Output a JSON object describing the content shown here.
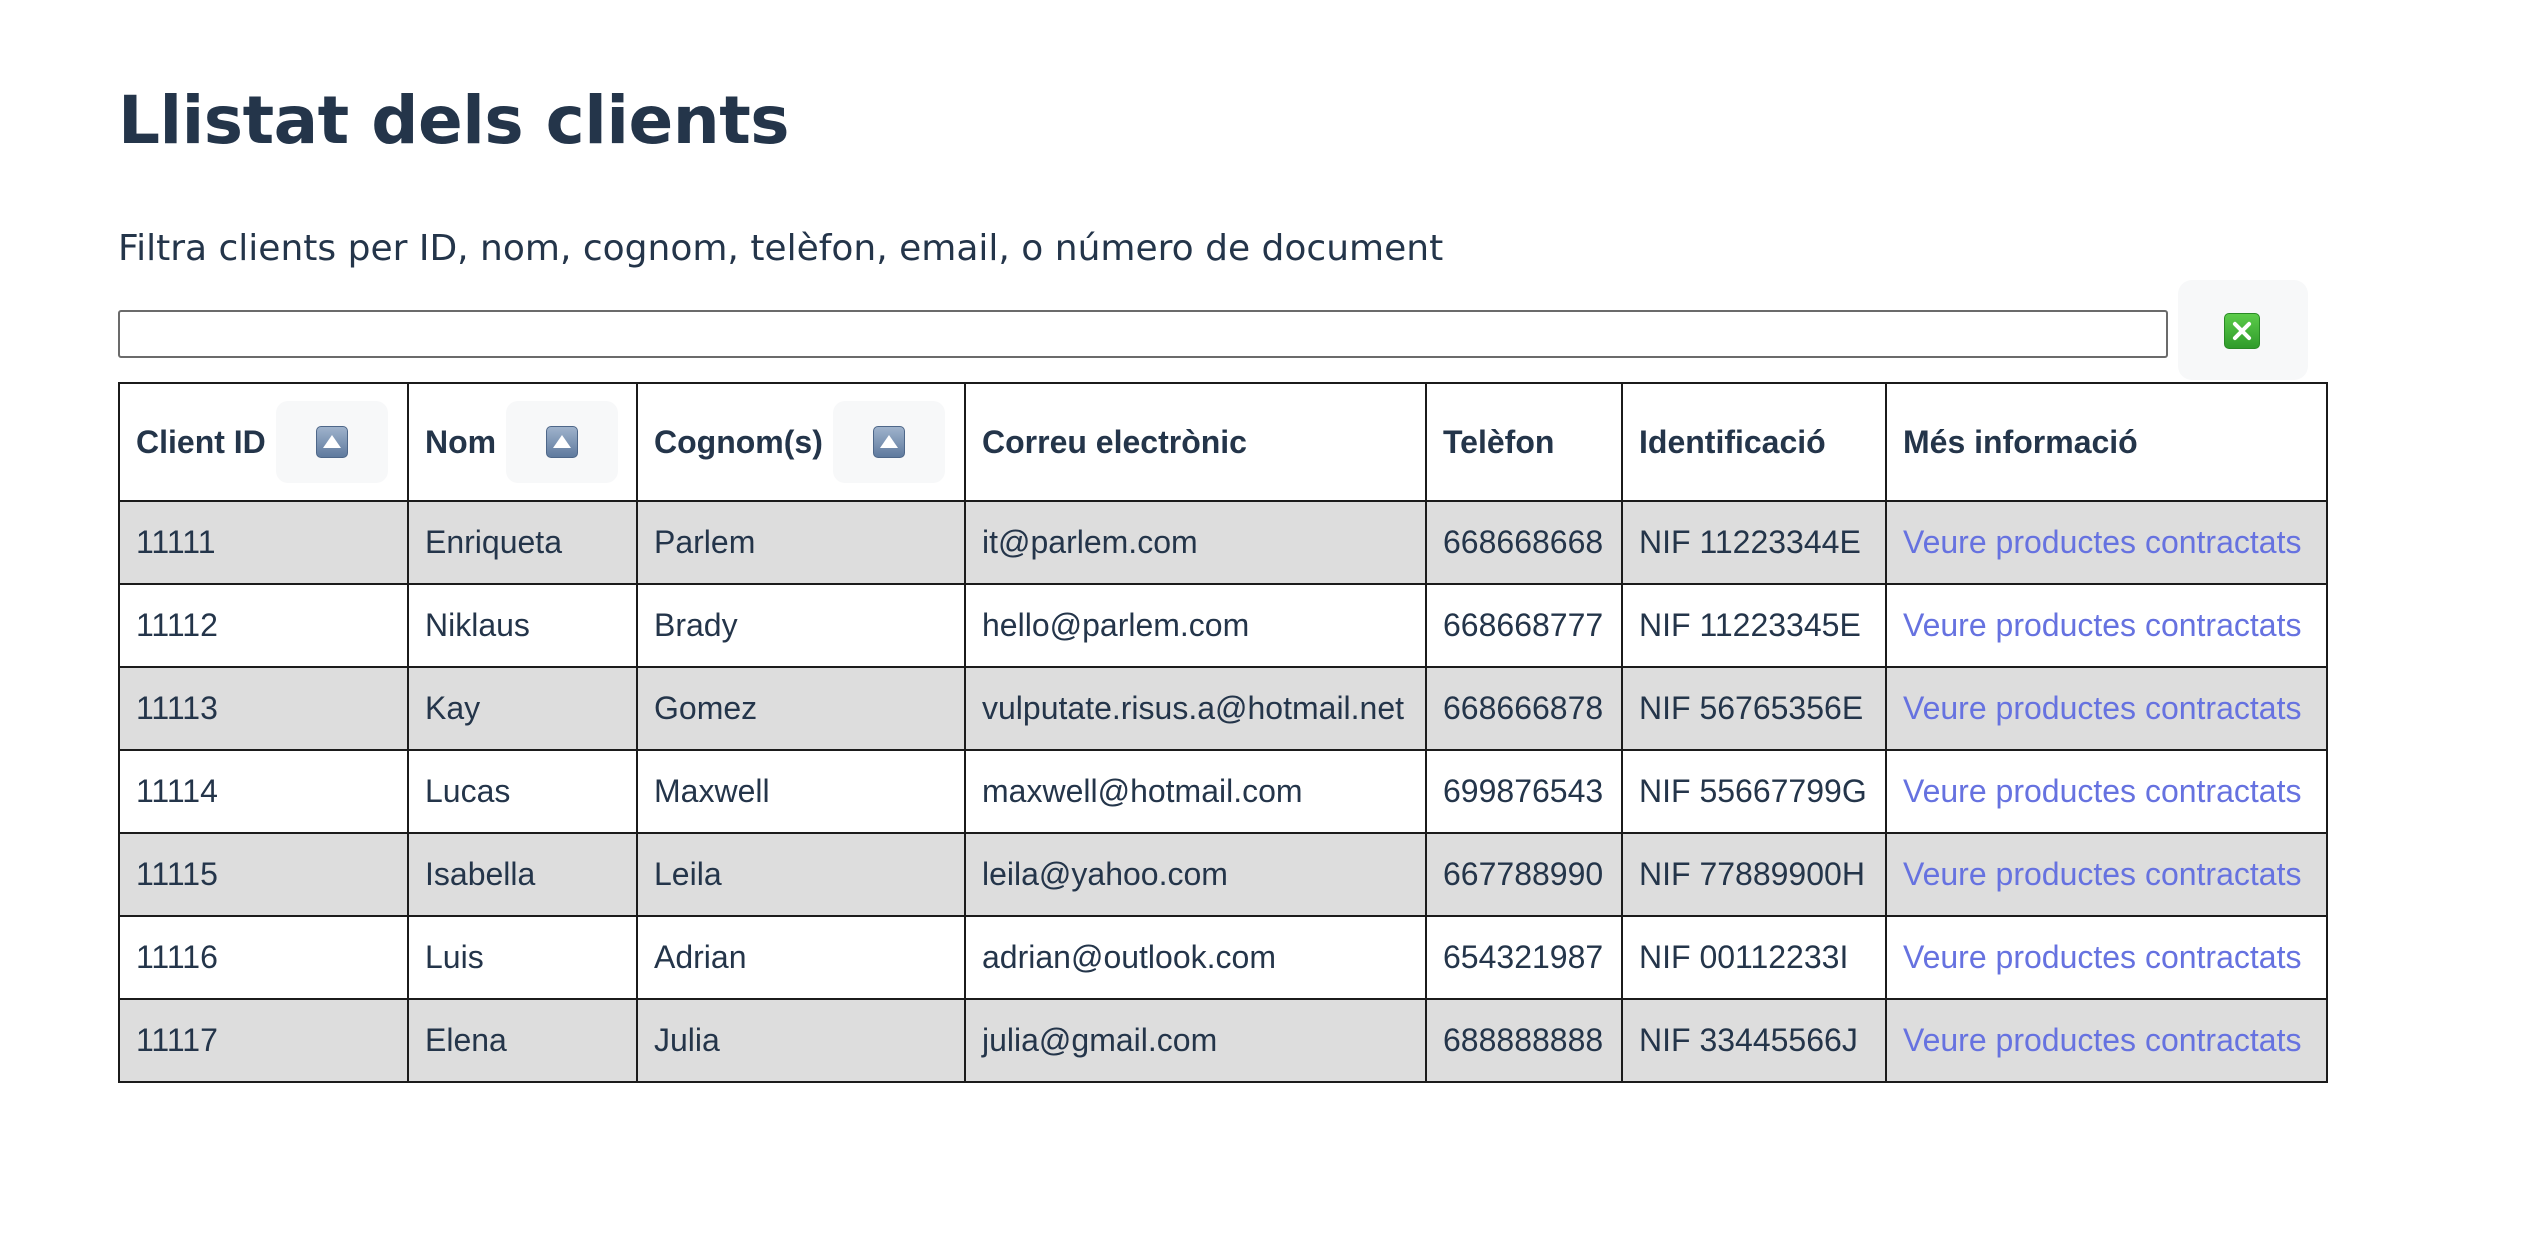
{
  "page": {
    "title": "Llistat dels clients"
  },
  "filter": {
    "label": "Filtra clients per ID, nom, cognom, telèfon, email, o número de document",
    "value": "",
    "placeholder": "",
    "clear_icon": "clear-x-icon"
  },
  "table": {
    "headers": {
      "client_id": "Client ID",
      "nom": "Nom",
      "cognom": "Cognom(s)",
      "email": "Correu electrònic",
      "telefon": "Telèfon",
      "identificacio": "Identificació",
      "mes_info": "Més informació"
    },
    "sort_icon": "sort-up-icon",
    "rows": [
      {
        "id": "11111",
        "nom": "Enriqueta",
        "cognom": "Parlem",
        "email": "it@parlem.com",
        "telefon": "668668668",
        "doc": "NIF 11223344E",
        "link": "Veure productes contractats"
      },
      {
        "id": "11112",
        "nom": "Niklaus",
        "cognom": "Brady",
        "email": "hello@parlem.com",
        "telefon": "668668777",
        "doc": "NIF 11223345E",
        "link": "Veure productes contractats"
      },
      {
        "id": "11113",
        "nom": "Kay",
        "cognom": "Gomez",
        "email": "vulputate.risus.a@hotmail.net",
        "telefon": "668666878",
        "doc": "NIF 56765356E",
        "link": "Veure productes contractats"
      },
      {
        "id": "11114",
        "nom": "Lucas",
        "cognom": "Maxwell",
        "email": "maxwell@hotmail.com",
        "telefon": "699876543",
        "doc": "NIF 55667799G",
        "link": "Veure productes contractats"
      },
      {
        "id": "11115",
        "nom": "Isabella",
        "cognom": "Leila",
        "email": "leila@yahoo.com",
        "telefon": "667788990",
        "doc": "NIF 77889900H",
        "link": "Veure productes contractats"
      },
      {
        "id": "11116",
        "nom": "Luis",
        "cognom": "Adrian",
        "email": "adrian@outlook.com",
        "telefon": "654321987",
        "doc": "NIF 00112233I",
        "link": "Veure productes contractats"
      },
      {
        "id": "11117",
        "nom": "Elena",
        "cognom": "Julia",
        "email": "julia@gmail.com",
        "telefon": "688888888",
        "doc": "NIF 33445566J",
        "link": "Veure productes contractats"
      }
    ]
  },
  "colors": {
    "text": "#24354a",
    "link": "#6672e0",
    "row_stripe": "#dddddd",
    "border": "#1b1b1b"
  }
}
